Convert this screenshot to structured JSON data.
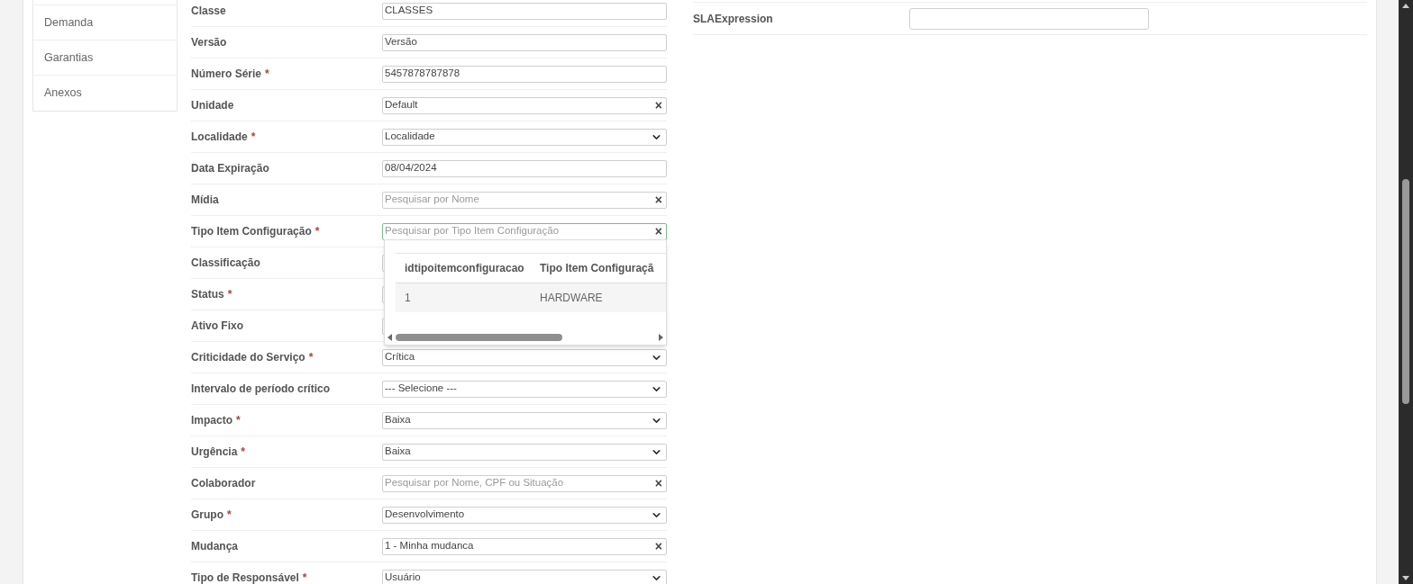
{
  "sidebar": {
    "items": [
      {
        "label": "Demanda"
      },
      {
        "label": "Garantias"
      },
      {
        "label": "Anexos"
      }
    ]
  },
  "form": {
    "fields": [
      {
        "label": "Classe",
        "required": false,
        "kind": "text",
        "value": "CLASSES"
      },
      {
        "label": "Versão",
        "required": false,
        "kind": "text",
        "value": "Versão"
      },
      {
        "label": "Número Série",
        "required": true,
        "kind": "text",
        "value": "5457878787878"
      },
      {
        "label": "Unidade",
        "required": false,
        "kind": "search",
        "value": "Default"
      },
      {
        "label": "Localidade",
        "required": true,
        "kind": "select",
        "value": "Localidade"
      },
      {
        "label": "Data Expiração",
        "required": false,
        "kind": "text",
        "value": "08/04/2024"
      },
      {
        "label": "Mídia",
        "required": false,
        "kind": "search",
        "placeholder": "Pesquisar por Nome"
      },
      {
        "label": "Tipo Item Configuração",
        "required": true,
        "kind": "search",
        "placeholder": "Pesquisar por Tipo Item Configuração",
        "focused": true
      },
      {
        "label": "Classificação",
        "required": false,
        "kind": "select"
      },
      {
        "label": "Status",
        "required": true,
        "kind": "select"
      },
      {
        "label": "Ativo Fixo",
        "required": false,
        "kind": "select"
      },
      {
        "label": "Criticidade do Serviço",
        "required": true,
        "kind": "select",
        "value": "Crítica"
      },
      {
        "label": "Intervalo de período crítico",
        "required": false,
        "kind": "select",
        "value": "--- Selecione ---"
      },
      {
        "label": "Impacto",
        "required": true,
        "kind": "select",
        "value": "Baixa"
      },
      {
        "label": "Urgência",
        "required": true,
        "kind": "select",
        "value": "Baixa"
      },
      {
        "label": "Colaborador",
        "required": false,
        "kind": "search",
        "placeholder": "Pesquisar por Nome, CPF ou Situação"
      },
      {
        "label": "Grupo",
        "required": true,
        "kind": "select",
        "value": "Desenvolvimento"
      },
      {
        "label": "Mudança",
        "required": false,
        "kind": "search",
        "value": "1 - Minha mudanca"
      },
      {
        "label": "Tipo de Responsável",
        "required": true,
        "kind": "select",
        "value": "Usuário"
      }
    ],
    "clear_symbol": "×",
    "required_mark": "*",
    "dropdown": {
      "columns": [
        "idtipoitemconfiguracao",
        "Tipo Item Configuraçã"
      ],
      "rows": [
        [
          "1",
          "HARDWARE"
        ]
      ]
    }
  },
  "right_form": {
    "fields": [
      {
        "label": "SLAExpression",
        "kind": "text"
      }
    ]
  }
}
